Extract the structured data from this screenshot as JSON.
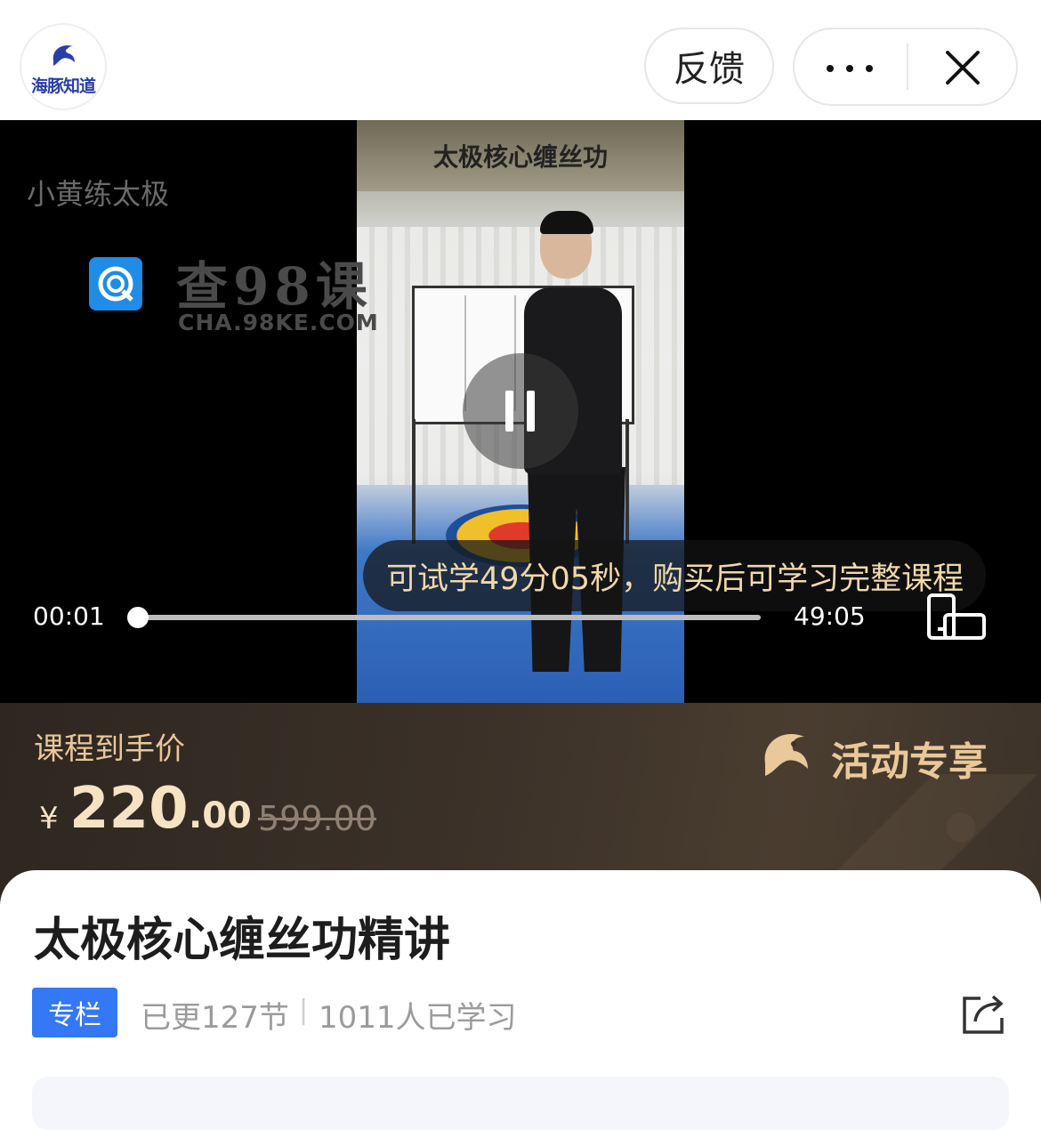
{
  "app": {
    "brand": "海豚知道",
    "feedback_label": "反馈"
  },
  "video": {
    "banner_title": "太极核心缠丝功",
    "author": "小黄练太极",
    "watermark_cn": "查98课",
    "watermark_en": "CHA.98KE.COM",
    "trial_tip": "可试学49分05秒，购买后可学习完整课程",
    "current_time": "00:01",
    "total_time": "49:05",
    "progress_fraction": 0.0003
  },
  "price": {
    "label": "课程到手价",
    "currency": "¥",
    "integer": "220",
    "decimal": ".00",
    "original": "599.00",
    "activity_label": "活动专享"
  },
  "course": {
    "title": "太极核心缠丝功精讲",
    "tag": "专栏",
    "updated": "已更127节",
    "separator": "|",
    "learners": "1011人已学习"
  },
  "icons": {
    "logo": "dolphin-logo-icon",
    "more": "more-dots-icon",
    "close": "close-icon",
    "pause": "pause-icon",
    "fullscreen": "rotate-fullscreen-icon",
    "activity": "dolphin-icon",
    "share": "share-icon"
  },
  "colors": {
    "brand_blue": "#2a3ea8",
    "tag_blue": "#3478f6",
    "price_gold": "#f6e3c4",
    "tip_gold": "#f1d8a8"
  }
}
